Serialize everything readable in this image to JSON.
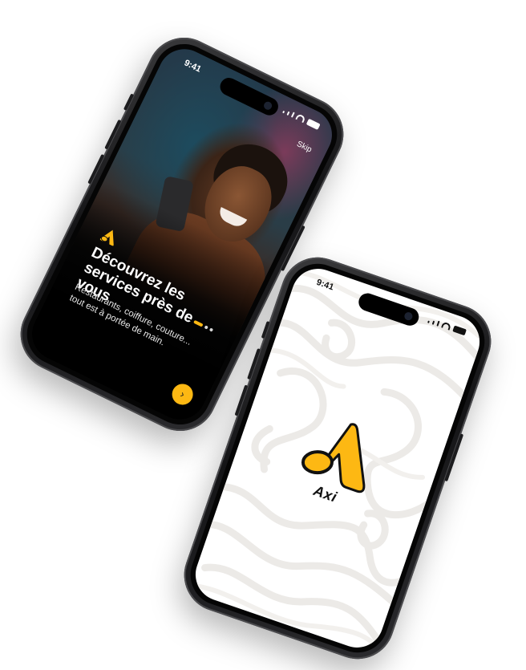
{
  "colors": {
    "accent": "#FDB813",
    "dark": "#111111",
    "topo_lines": "#ECEAE7"
  },
  "onboarding_phone": {
    "status": {
      "time": "9:41"
    },
    "skip_label": "Skip",
    "logo_icon": "axi-logo-icon",
    "title": "Découvrez les services près de vous",
    "subtitle": "Restaurants, coiffure, couture... tout est à portée de main.",
    "pager": {
      "count": 3,
      "active": 1
    },
    "next_icon": "chevron-right-icon"
  },
  "splash_phone": {
    "status": {
      "time": "9:41"
    },
    "logo_icon": "axi-logo-icon",
    "app_name": "Axi"
  }
}
